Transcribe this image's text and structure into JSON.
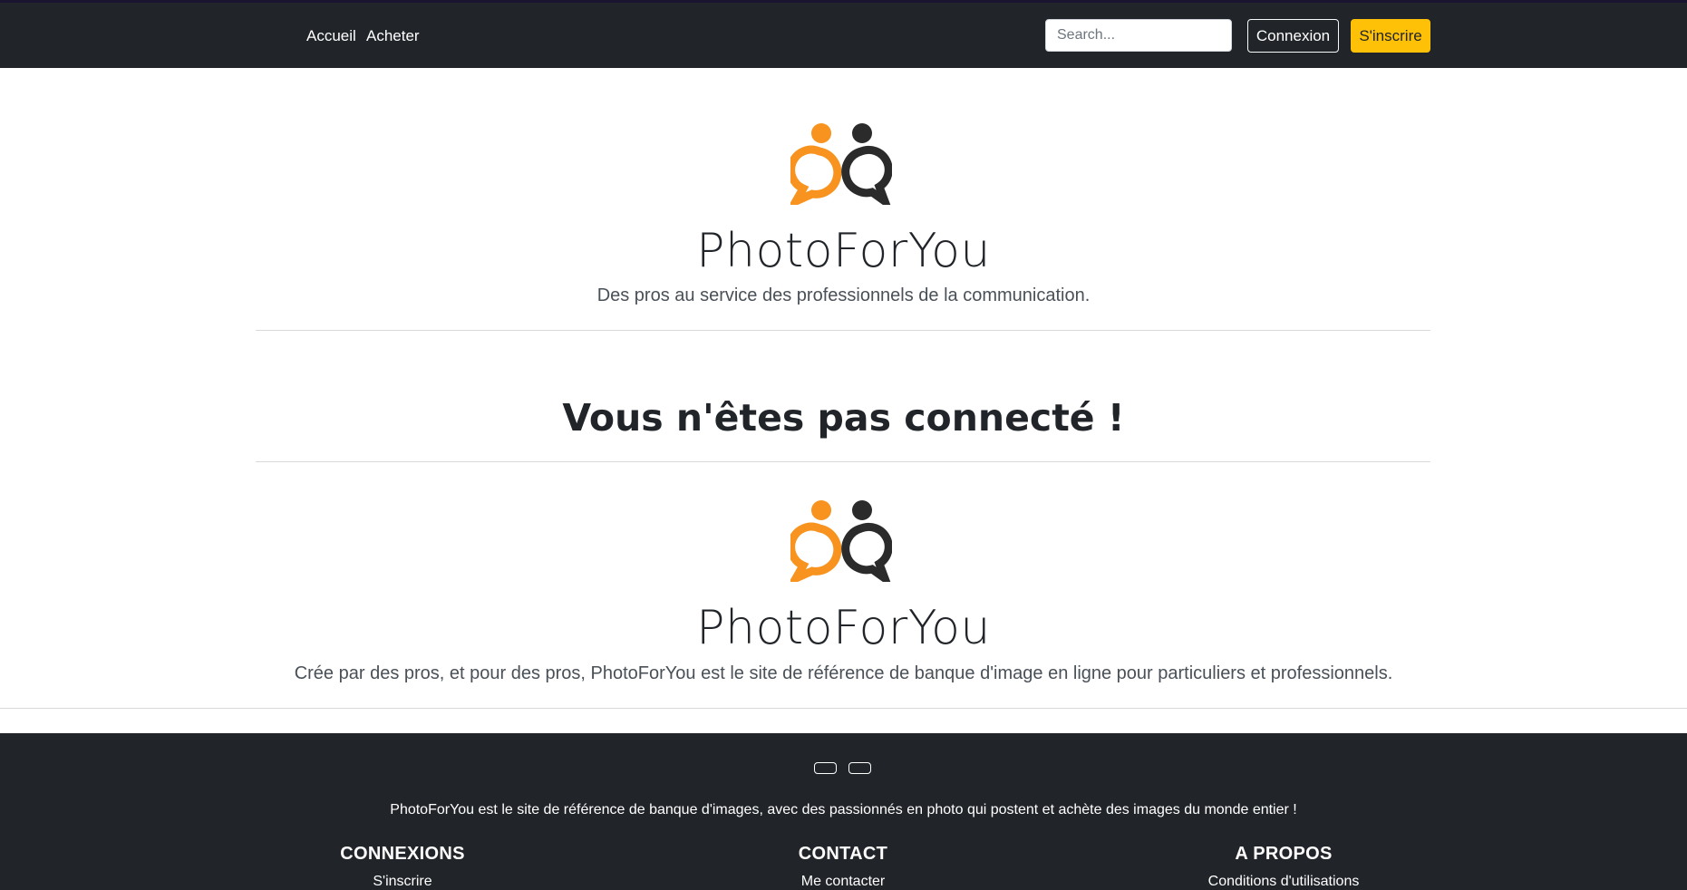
{
  "nav": {
    "links": [
      "Accueil",
      "Acheter"
    ],
    "search_placeholder": "Search...",
    "login_label": "Connexion",
    "signup_label": "S'inscrire"
  },
  "hero": {
    "brand": "PhotoForYou",
    "tagline": "Des pros au service des professionnels de la communication."
  },
  "message": {
    "heading": "Vous n'êtes pas connecté !"
  },
  "about": {
    "brand": "PhotoForYou",
    "description": "Crée par des pros, et pour des pros, PhotoForYou est le site de référence de banque d'image en ligne pour particuliers et professionnels."
  },
  "footer": {
    "text": "PhotoForYou est le site de référence de banque d'images, avec des passionnés en photo qui postent et achète des images du monde entier !",
    "columns": [
      {
        "title": "CONNEXIONS",
        "link": "S'inscrire"
      },
      {
        "title": "CONTACT",
        "link": "Me contacter"
      },
      {
        "title": "A PROPOS",
        "link": "Conditions d'utilisations"
      }
    ]
  },
  "colors": {
    "navbar": "#212529",
    "accent": "#ffc107",
    "logo_orange": "#f7931e",
    "logo_dark": "#2b2b2b"
  }
}
